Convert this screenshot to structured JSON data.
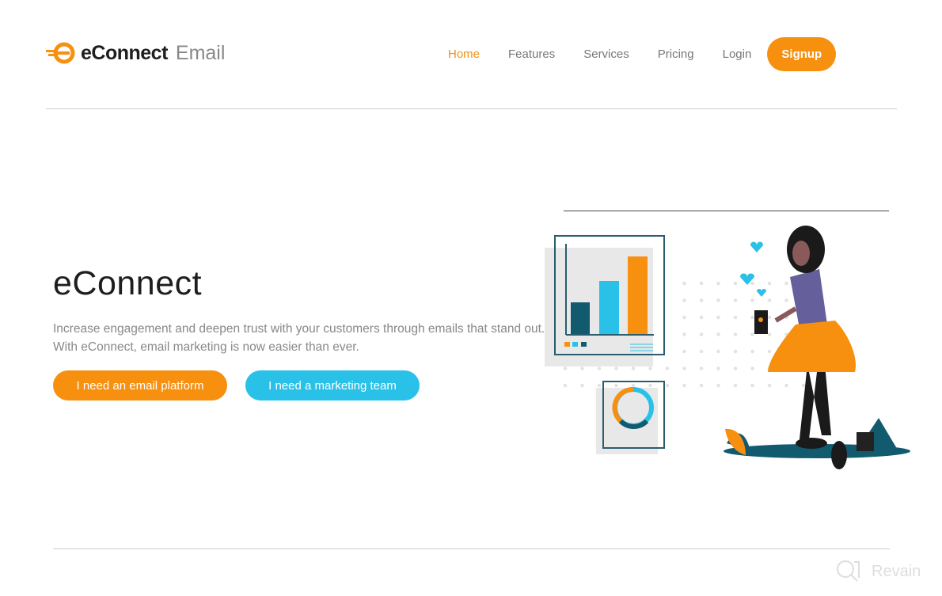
{
  "header": {
    "logo_primary": "eConnect",
    "logo_secondary": "Email",
    "nav": [
      "Home",
      "Features",
      "Services",
      "Pricing",
      "Login"
    ],
    "signup": "Signup"
  },
  "hero": {
    "title": "eConnect",
    "description": "Increase engagement and deepen trust with your customers through emails that stand out. With eConnect, email marketing is now easier than ever.",
    "primary_button": "I need an email platform",
    "secondary_button": "I need a marketing team"
  },
  "watermark": "Revain",
  "colors": {
    "accent": "#f7900f",
    "secondary": "#29c1e8",
    "dark_teal": "#125a6e"
  }
}
